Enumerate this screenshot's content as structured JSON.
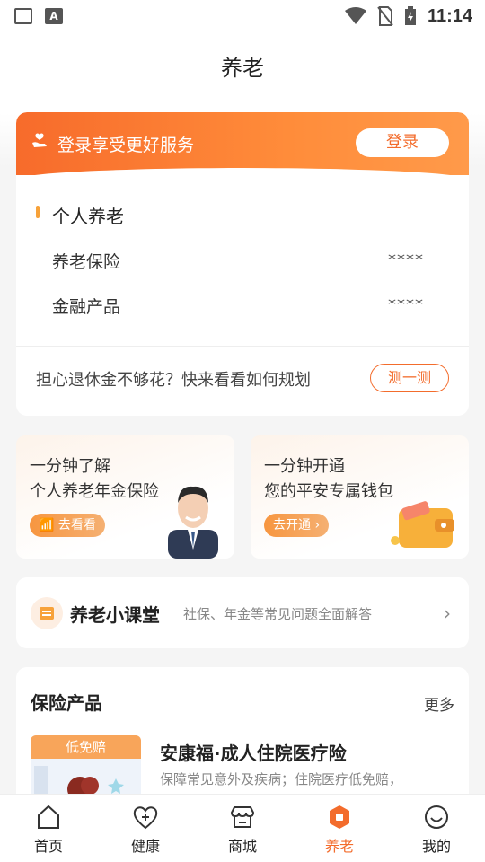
{
  "status": {
    "time": "11:14"
  },
  "header": {
    "title": "养老"
  },
  "login": {
    "text": "登录享受更好服务",
    "button": "登录"
  },
  "personal": {
    "title": "个人养老",
    "rows": [
      {
        "label": "养老保险",
        "value": "****"
      },
      {
        "label": "金融产品",
        "value": "****"
      }
    ]
  },
  "retire": {
    "text": "担心退休金不够花？快来看看如何规划",
    "button": "测一测"
  },
  "promos": [
    {
      "line1": "一分钟了解",
      "line2": "个人养老年金保险",
      "button": "去看看"
    },
    {
      "line1": "一分钟开通",
      "line2": "您的平安专属钱包",
      "button": "去开通"
    }
  ],
  "classroom": {
    "title": "养老小课堂",
    "desc": "社保、年金等常见问题全面解答"
  },
  "insurance": {
    "title": "保险产品",
    "more": "更多",
    "product": {
      "badge": "低免赔",
      "name": "安康福·成人住院医疗险",
      "desc": "保障常见意外及疾病；住院医疗低免赔，"
    }
  },
  "tabs": [
    {
      "label": "首页",
      "icon": "home-icon"
    },
    {
      "label": "健康",
      "icon": "heart-plus-icon"
    },
    {
      "label": "商城",
      "icon": "store-icon"
    },
    {
      "label": "养老",
      "icon": "pension-icon"
    },
    {
      "label": "我的",
      "icon": "smile-icon"
    }
  ],
  "colors": {
    "accent": "#f36c2c",
    "accent_light": "#f7a23a"
  }
}
